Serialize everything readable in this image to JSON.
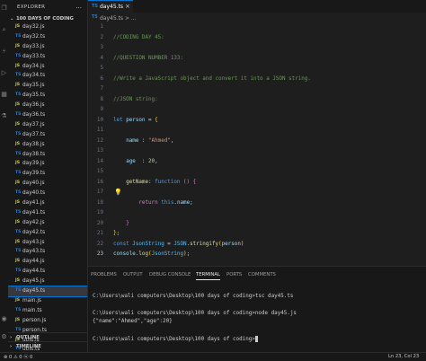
{
  "explorer": {
    "title": "EXPLORER",
    "more": "...",
    "folder_chevron": "⌄",
    "folder": "100 DAYS OF CODING",
    "files": [
      {
        "icon": "JS",
        "kind": "js",
        "name": "day32.js",
        "selected": false
      },
      {
        "icon": "TS",
        "kind": "ts",
        "name": "day32.ts",
        "selected": false
      },
      {
        "icon": "JS",
        "kind": "js",
        "name": "day33.js",
        "selected": false
      },
      {
        "icon": "TS",
        "kind": "ts",
        "name": "day33.ts",
        "selected": false
      },
      {
        "icon": "JS",
        "kind": "js",
        "name": "day34.js",
        "selected": false
      },
      {
        "icon": "TS",
        "kind": "ts",
        "name": "day34.ts",
        "selected": false
      },
      {
        "icon": "JS",
        "kind": "js",
        "name": "day35.js",
        "selected": false
      },
      {
        "icon": "TS",
        "kind": "ts",
        "name": "day35.ts",
        "selected": false
      },
      {
        "icon": "JS",
        "kind": "js",
        "name": "day36.js",
        "selected": false
      },
      {
        "icon": "TS",
        "kind": "ts",
        "name": "day36.ts",
        "selected": false
      },
      {
        "icon": "JS",
        "kind": "js",
        "name": "day37.js",
        "selected": false
      },
      {
        "icon": "TS",
        "kind": "ts",
        "name": "day37.ts",
        "selected": false
      },
      {
        "icon": "JS",
        "kind": "js",
        "name": "day38.js",
        "selected": false
      },
      {
        "icon": "TS",
        "kind": "ts",
        "name": "day38.ts",
        "selected": false
      },
      {
        "icon": "JS",
        "kind": "js",
        "name": "day39.js",
        "selected": false
      },
      {
        "icon": "TS",
        "kind": "ts",
        "name": "day39.ts",
        "selected": false
      },
      {
        "icon": "JS",
        "kind": "js",
        "name": "day40.js",
        "selected": false
      },
      {
        "icon": "TS",
        "kind": "ts",
        "name": "day40.ts",
        "selected": false
      },
      {
        "icon": "JS",
        "kind": "js",
        "name": "day41.js",
        "selected": false
      },
      {
        "icon": "TS",
        "kind": "ts",
        "name": "day41.ts",
        "selected": false
      },
      {
        "icon": "JS",
        "kind": "js",
        "name": "day42.js",
        "selected": false
      },
      {
        "icon": "TS",
        "kind": "ts",
        "name": "day42.ts",
        "selected": false
      },
      {
        "icon": "JS",
        "kind": "js",
        "name": "day43.js",
        "selected": false
      },
      {
        "icon": "TS",
        "kind": "ts",
        "name": "day43.ts",
        "selected": false
      },
      {
        "icon": "JS",
        "kind": "js",
        "name": "day44.js",
        "selected": false
      },
      {
        "icon": "TS",
        "kind": "ts",
        "name": "day44.ts",
        "selected": false
      },
      {
        "icon": "JS",
        "kind": "js",
        "name": "day45.js",
        "selected": false
      },
      {
        "icon": "TS",
        "kind": "ts",
        "name": "day45.ts",
        "selected": true
      },
      {
        "icon": "JS",
        "kind": "js",
        "name": "main.js",
        "selected": false
      },
      {
        "icon": "TS",
        "kind": "ts",
        "name": "main.ts",
        "selected": false
      },
      {
        "icon": "JS",
        "kind": "js",
        "name": "person.js",
        "selected": false
      },
      {
        "icon": "TS",
        "kind": "ts",
        "name": "person.ts",
        "selected": false
      },
      {
        "icon": "JS",
        "kind": "js",
        "name": "utils.js",
        "selected": false
      },
      {
        "icon": "TS",
        "kind": "ts",
        "name": "utils.ts",
        "selected": false
      }
    ],
    "outline": "OUTLINE",
    "timeline": "TIMELINE",
    "section_chevron": "›"
  },
  "tab": {
    "icon": "TS",
    "label": "day45.ts",
    "close": "×"
  },
  "breadcrumb": {
    "icon": "TS",
    "text": "day45.ts > ..."
  },
  "colors": {
    "accent": "#0078d4",
    "comment": "#6a9955",
    "keyword": "#569cd6",
    "string": "#ce9178",
    "function": "#dcdcaa",
    "variable": "#9cdcfe"
  },
  "editor": {
    "active_line": 23,
    "lines": [
      {
        "n": "1",
        "parts": []
      },
      {
        "n": "2",
        "parts": [
          [
            "com",
            "//CODING DAY 45:"
          ]
        ]
      },
      {
        "n": "3",
        "parts": []
      },
      {
        "n": "4",
        "parts": [
          [
            "com",
            "//QUESTION NUMBER 133:"
          ]
        ]
      },
      {
        "n": "5",
        "parts": []
      },
      {
        "n": "6",
        "parts": [
          [
            "com",
            "//Write a JavaScript object and convert it into a JSON string."
          ]
        ]
      },
      {
        "n": "7",
        "parts": []
      },
      {
        "n": "8",
        "parts": [
          [
            "com",
            "//JSON string:"
          ]
        ]
      },
      {
        "n": "9",
        "parts": []
      },
      {
        "n": "10",
        "parts": [
          [
            "kw",
            "let"
          ],
          [
            "pun",
            " "
          ],
          [
            "var",
            "person"
          ],
          [
            "pun",
            " = "
          ],
          [
            "br1",
            "{"
          ]
        ]
      },
      {
        "n": "11",
        "parts": []
      },
      {
        "n": "12",
        "parts": [
          [
            "pun",
            "    "
          ],
          [
            "var",
            "name"
          ],
          [
            "pun",
            " : "
          ],
          [
            "str",
            "\"Ahmed\""
          ],
          [
            "pun",
            ","
          ]
        ]
      },
      {
        "n": "13",
        "parts": []
      },
      {
        "n": "14",
        "parts": [
          [
            "pun",
            "    "
          ],
          [
            "var",
            "age"
          ],
          [
            "pun",
            "  : "
          ],
          [
            "num",
            "20"
          ],
          [
            "pun",
            ","
          ]
        ]
      },
      {
        "n": "15",
        "parts": []
      },
      {
        "n": "16",
        "parts": [
          [
            "pun",
            "    "
          ],
          [
            "fn",
            "getName"
          ],
          [
            "pun",
            ": "
          ],
          [
            "kw",
            "function"
          ],
          [
            "pun",
            " "
          ],
          [
            "br2",
            "()"
          ],
          [
            "pun",
            " "
          ],
          [
            "br2",
            "{"
          ]
        ]
      },
      {
        "n": "17",
        "parts": []
      },
      {
        "n": "18",
        "parts": [
          [
            "pun",
            "        "
          ],
          [
            "ctl",
            "return"
          ],
          [
            "pun",
            " "
          ],
          [
            "kw",
            "this"
          ],
          [
            "pun",
            "."
          ],
          [
            "var",
            "name"
          ],
          [
            "pun",
            ";"
          ]
        ]
      },
      {
        "n": "19",
        "parts": []
      },
      {
        "n": "20",
        "parts": [
          [
            "pun",
            "    "
          ],
          [
            "br2",
            "}"
          ]
        ]
      },
      {
        "n": "21",
        "parts": [
          [
            "br1",
            "}"
          ],
          [
            "pun",
            ";"
          ]
        ]
      },
      {
        "n": "22",
        "parts": [
          [
            "kw",
            "const"
          ],
          [
            "pun",
            " "
          ],
          [
            "con",
            "JsonString"
          ],
          [
            "pun",
            " = "
          ],
          [
            "con",
            "JSON"
          ],
          [
            "pun",
            "."
          ],
          [
            "fn",
            "stringify"
          ],
          [
            "br1",
            "("
          ],
          [
            "var",
            "person"
          ],
          [
            "br1",
            ")"
          ]
        ]
      },
      {
        "n": "23",
        "parts": [
          [
            "var",
            "console"
          ],
          [
            "pun",
            "."
          ],
          [
            "fn",
            "log"
          ],
          [
            "br1",
            "("
          ],
          [
            "con",
            "JsonString"
          ],
          [
            "br1",
            ")"
          ],
          [
            "pun",
            ";"
          ]
        ]
      }
    ]
  },
  "panel": {
    "tabs": [
      {
        "label": "PROBLEMS",
        "active": false
      },
      {
        "label": "OUTPUT",
        "active": false
      },
      {
        "label": "DEBUG CONSOLE",
        "active": false
      },
      {
        "label": "TERMINAL",
        "active": true
      },
      {
        "label": "PORTS",
        "active": false
      },
      {
        "label": "COMMENTS",
        "active": false
      }
    ],
    "terminal_lines": [
      "C:\\Users\\wali computers\\Desktop\\100 days of coding>tsc day45.ts",
      "",
      "C:\\Users\\wali computers\\Desktop\\100 days of coding>node day45.js",
      "{\"name\":\"Ahmed\",\"age\":20}",
      "",
      "C:\\Users\\wali computers\\Desktop\\100 days of coding>"
    ]
  },
  "status": {
    "left": "⊗ 0 ⚠ 0   ⓦ 0",
    "right": "Ln 23, Col 23"
  }
}
